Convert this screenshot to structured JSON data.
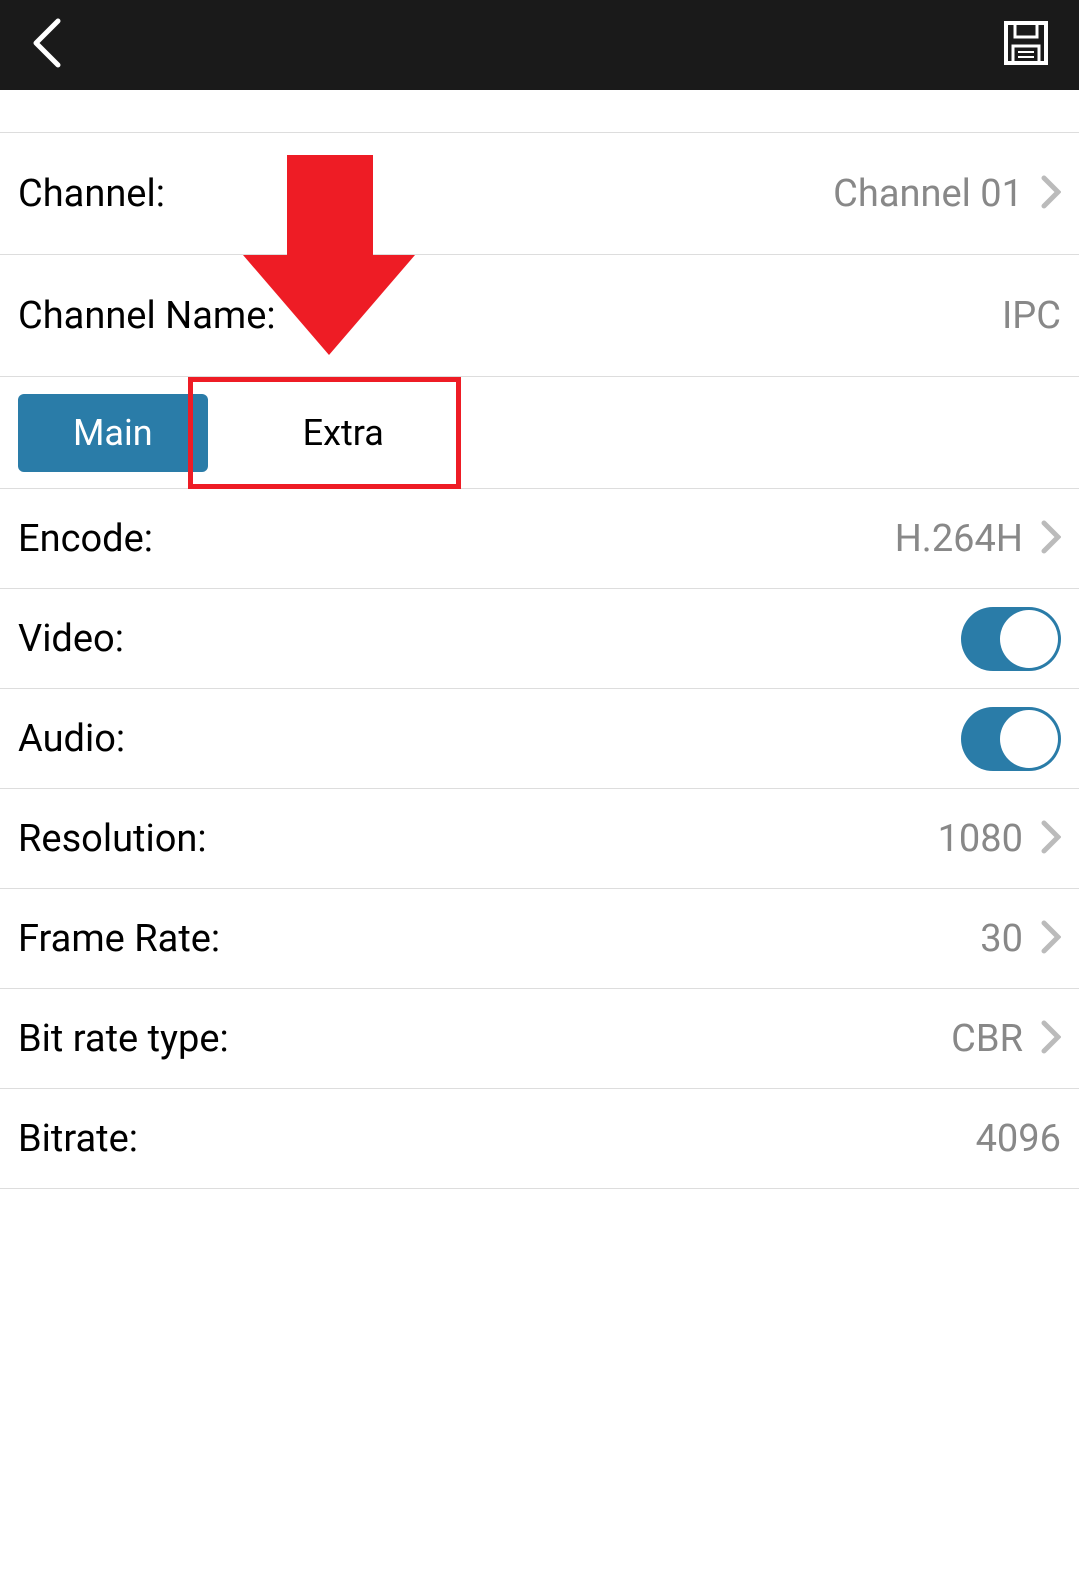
{
  "settings": {
    "channel": {
      "label": "Channel:",
      "value": "Channel 01"
    },
    "channelName": {
      "label": "Channel Name:",
      "value": "IPC"
    },
    "tabs": {
      "main": "Main",
      "extra": "Extra"
    },
    "encode": {
      "label": "Encode:",
      "value": "H.264H"
    },
    "video": {
      "label": "Video:"
    },
    "audio": {
      "label": "Audio:"
    },
    "resolution": {
      "label": "Resolution:",
      "value": "1080"
    },
    "frameRate": {
      "label": "Frame Rate:",
      "value": "30"
    },
    "bitrateType": {
      "label": "Bit rate type:",
      "value": "CBR"
    },
    "bitrate": {
      "label": "Bitrate:",
      "value": "4096"
    }
  }
}
